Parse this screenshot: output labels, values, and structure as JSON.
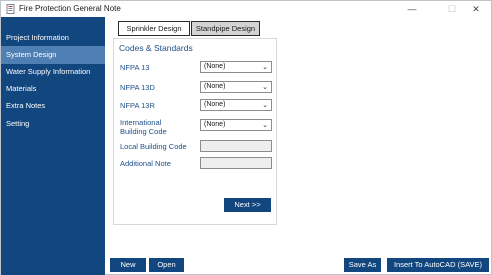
{
  "window": {
    "title": "Fire Protection General Note",
    "controls": {
      "minimize": "—",
      "maximize": "☐",
      "close": "✕"
    }
  },
  "sidebar": {
    "items": [
      {
        "label": "Project Information",
        "active": false
      },
      {
        "label": "System Design",
        "active": true
      },
      {
        "label": "Water Supply Information",
        "active": false
      },
      {
        "label": "Materials",
        "active": false
      },
      {
        "label": "Extra Notes",
        "active": false
      },
      {
        "label": "Setting",
        "active": false
      }
    ]
  },
  "tabs": [
    {
      "label": "Sprinkler Design",
      "active": true
    },
    {
      "label": "Standpipe Design",
      "active": false
    }
  ],
  "codes": {
    "title": "Codes & Standards",
    "fields": [
      {
        "label": "NFPA 13",
        "value": "(None)",
        "type": "select"
      },
      {
        "label": "NFPA 13D",
        "value": "(None)",
        "type": "select"
      },
      {
        "label": "NFPA 13R",
        "value": "(None)",
        "type": "select"
      },
      {
        "label": "International Building Code",
        "value": "(None)",
        "type": "select"
      },
      {
        "label": "Local Building Code",
        "value": "",
        "type": "text"
      },
      {
        "label": "Additional Note",
        "value": "",
        "type": "text"
      }
    ],
    "next_label": "Next >>"
  },
  "footer": {
    "new_label": "New",
    "open_label": "Open",
    "save_as_label": "Save As",
    "insert_label": "Insert To AutoCAD (SAVE)"
  },
  "colors": {
    "sidebar": "#12467e",
    "sidebar_active": "#4f7fb3",
    "button": "#12467e",
    "label_text": "#1d4f86"
  },
  "icons": {
    "app": "app-document-icon",
    "dropdown": "chevron-down-icon"
  }
}
